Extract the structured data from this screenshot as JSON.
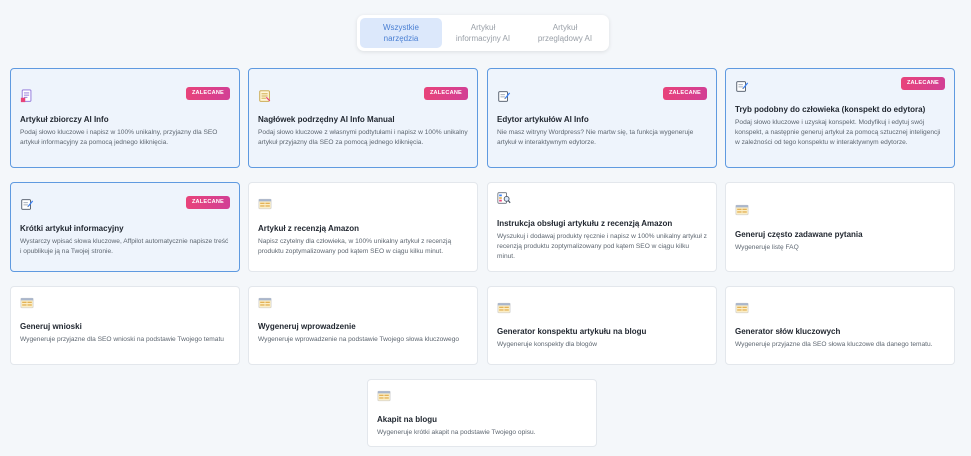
{
  "tabs": [
    {
      "label": "Wszystkie\nnarzędzia",
      "active": true
    },
    {
      "label": "Artykuł\ninformacyjny AI",
      "active": false
    },
    {
      "label": "Artykuł\nprzeglądowy AI",
      "active": false
    }
  ],
  "badge_label": "ZALECANE",
  "cards": [
    {
      "title": "Artykuł zbiorczy AI Info",
      "desc": "Podaj słowo kluczowe i napisz w 100% unikalny, przyjazny dla SEO artykuł informacyjny za pomocą jednego kliknięcia.",
      "icon": "document-icon",
      "featured": true
    },
    {
      "title": "Nagłówek podrzędny AI Info Manual",
      "desc": "Podaj słowo kluczowe z własnymi podtytułami i napisz w 100% unikalny artykuł przyjazny dla SEO za pomocą jednego kliknięcia.",
      "icon": "notepad-icon",
      "featured": true
    },
    {
      "title": "Edytor artykułów AI Info",
      "desc": "Nie masz witryny Wordpress? Nie martw się, ta funkcja wygeneruje artykuł w interaktywnym edytorze.",
      "icon": "edit-icon",
      "featured": true
    },
    {
      "title": "Tryb podobny do człowieka (konspekt do edytora)",
      "desc": "Podaj słowo kluczowe i uzyskaj konspekt. Modyfikuj i edytuj swój konspekt, a następnie generuj artykuł za pomocą sztucznej inteligencji w zależności od tego konspektu w interaktywnym edytorze.",
      "icon": "edit-icon",
      "featured": true
    },
    {
      "title": "Krótki artykuł informacyjny",
      "desc": "Wystarczy wpisać słowa kluczowe, Affpilot automatycznie napisze treść i opublikuje ją na Twojej stronie.",
      "icon": "edit-icon",
      "featured": true
    },
    {
      "title": "Artykuł z recenzją Amazon",
      "desc": "Napisz czytelny dla człowieka, w 100% unikalny artykuł z recenzją produktu zoptymalizowany pod kątem SEO w ciągu kilku minut.",
      "icon": "table-icon",
      "featured": false
    },
    {
      "title": "Instrukcja obsługi artykułu z recenzją Amazon",
      "desc": "Wyszukuj i dodawaj produkty ręcznie i napisz w 100% unikalny artykuł z recenzją produktu zoptymalizowany pod kątem SEO w ciągu kilku minut.",
      "icon": "search-document-icon",
      "featured": false
    },
    {
      "title": "Generuj często zadawane pytania",
      "desc": "Wygeneruje listę FAQ",
      "icon": "table-icon",
      "featured": false
    },
    {
      "title": "Generuj wnioski",
      "desc": "Wygeneruje przyjazne dla SEO wnioski na podstawie Twojego tematu",
      "icon": "table-icon",
      "featured": false
    },
    {
      "title": "Wygeneruj wprowadzenie",
      "desc": "Wygeneruje wprowadzenie na podstawie Twojego słowa kluczowego",
      "icon": "table-icon",
      "featured": false
    },
    {
      "title": "Generator konspektu artykułu na blogu",
      "desc": "Wygeneruje konspekty dla blogów",
      "icon": "table-icon",
      "featured": false
    },
    {
      "title": "Generator słów kluczowych",
      "desc": "Wygeneruje przyjazne dla SEO słowa kluczowe dla danego tematu.",
      "icon": "table-icon",
      "featured": false
    },
    {
      "title": "Akapit na blogu",
      "desc": "Wygeneruje krótki akapit na podstawie Twojego opisu.",
      "icon": "table-icon",
      "featured": false
    }
  ]
}
